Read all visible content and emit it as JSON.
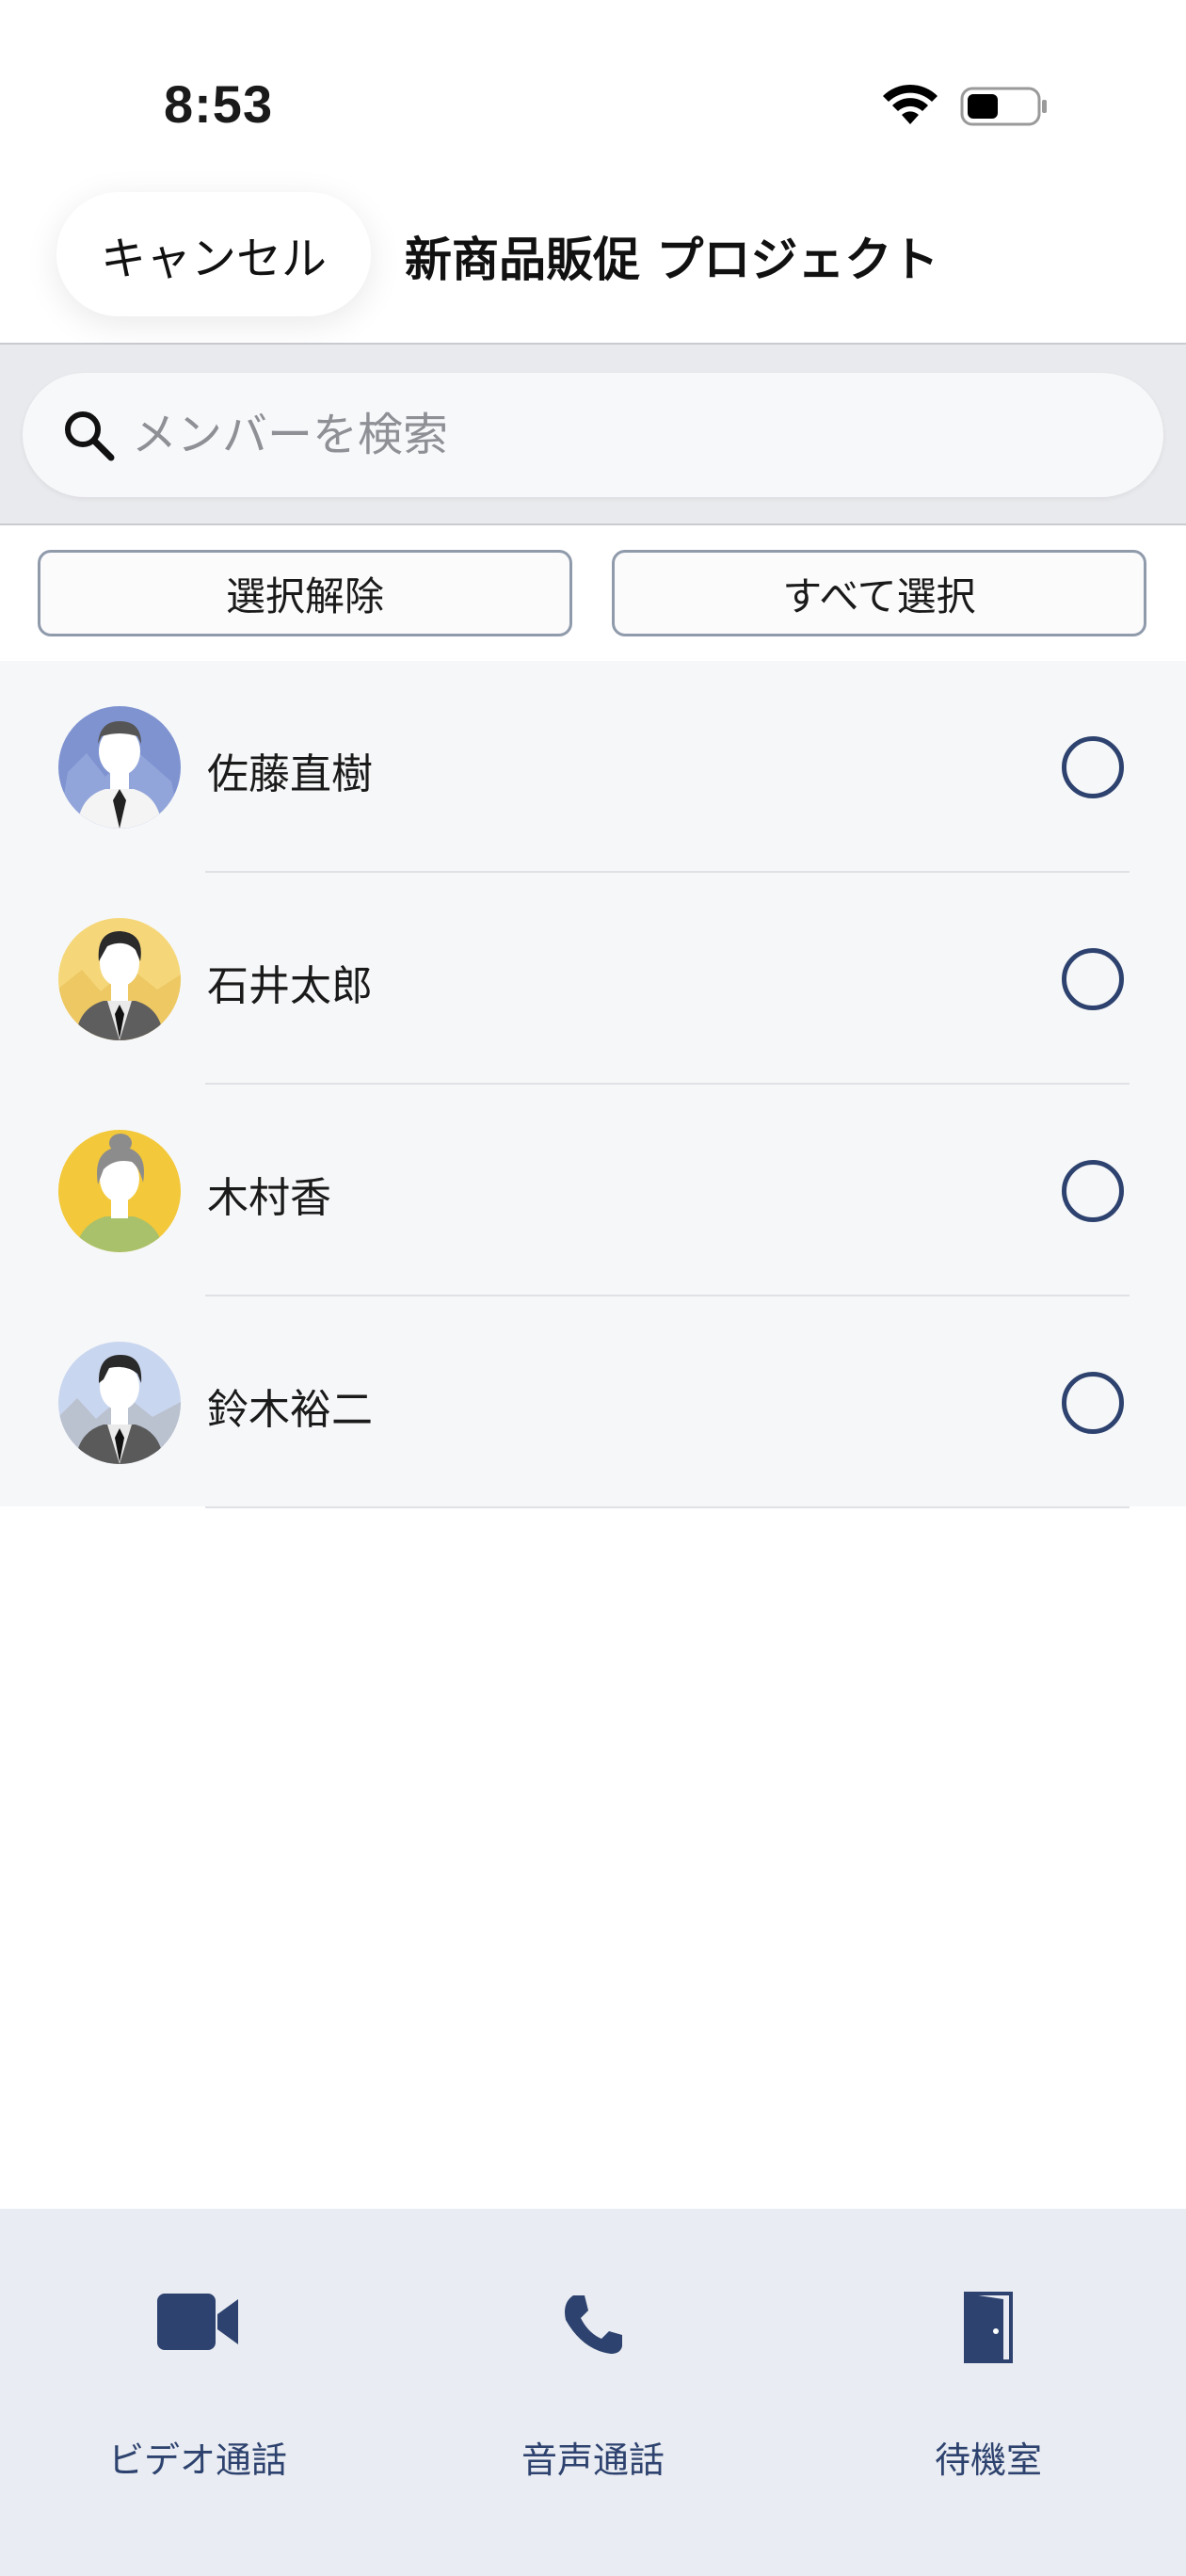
{
  "status_bar": {
    "time": "8:53"
  },
  "header": {
    "cancel_label": "キャンセル",
    "title": "新商品販促 プロジェクト"
  },
  "search": {
    "placeholder": "メンバーを検索",
    "value": ""
  },
  "actions": {
    "deselect_label": "選択解除",
    "select_all_label": "すべて選択"
  },
  "members": [
    {
      "name": "佐藤直樹",
      "selected": false,
      "avatar_bg": "#7f93d1"
    },
    {
      "name": "石井太郎",
      "selected": false,
      "avatar_bg": "#f5d77a"
    },
    {
      "name": "木村香",
      "selected": false,
      "avatar_bg": "#f3c83a"
    },
    {
      "name": "鈴木裕二",
      "selected": false,
      "avatar_bg": "#c9d6ef"
    }
  ],
  "tab_bar": [
    {
      "label": "ビデオ通話",
      "icon": "video-camera-icon"
    },
    {
      "label": "音声通話",
      "icon": "phone-icon"
    },
    {
      "label": "待機室",
      "icon": "door-icon"
    }
  ],
  "colors": {
    "accent": "#2d426e",
    "tab_bar_bg": "#e9ecf2",
    "list_bg": "#f6f7f9"
  }
}
